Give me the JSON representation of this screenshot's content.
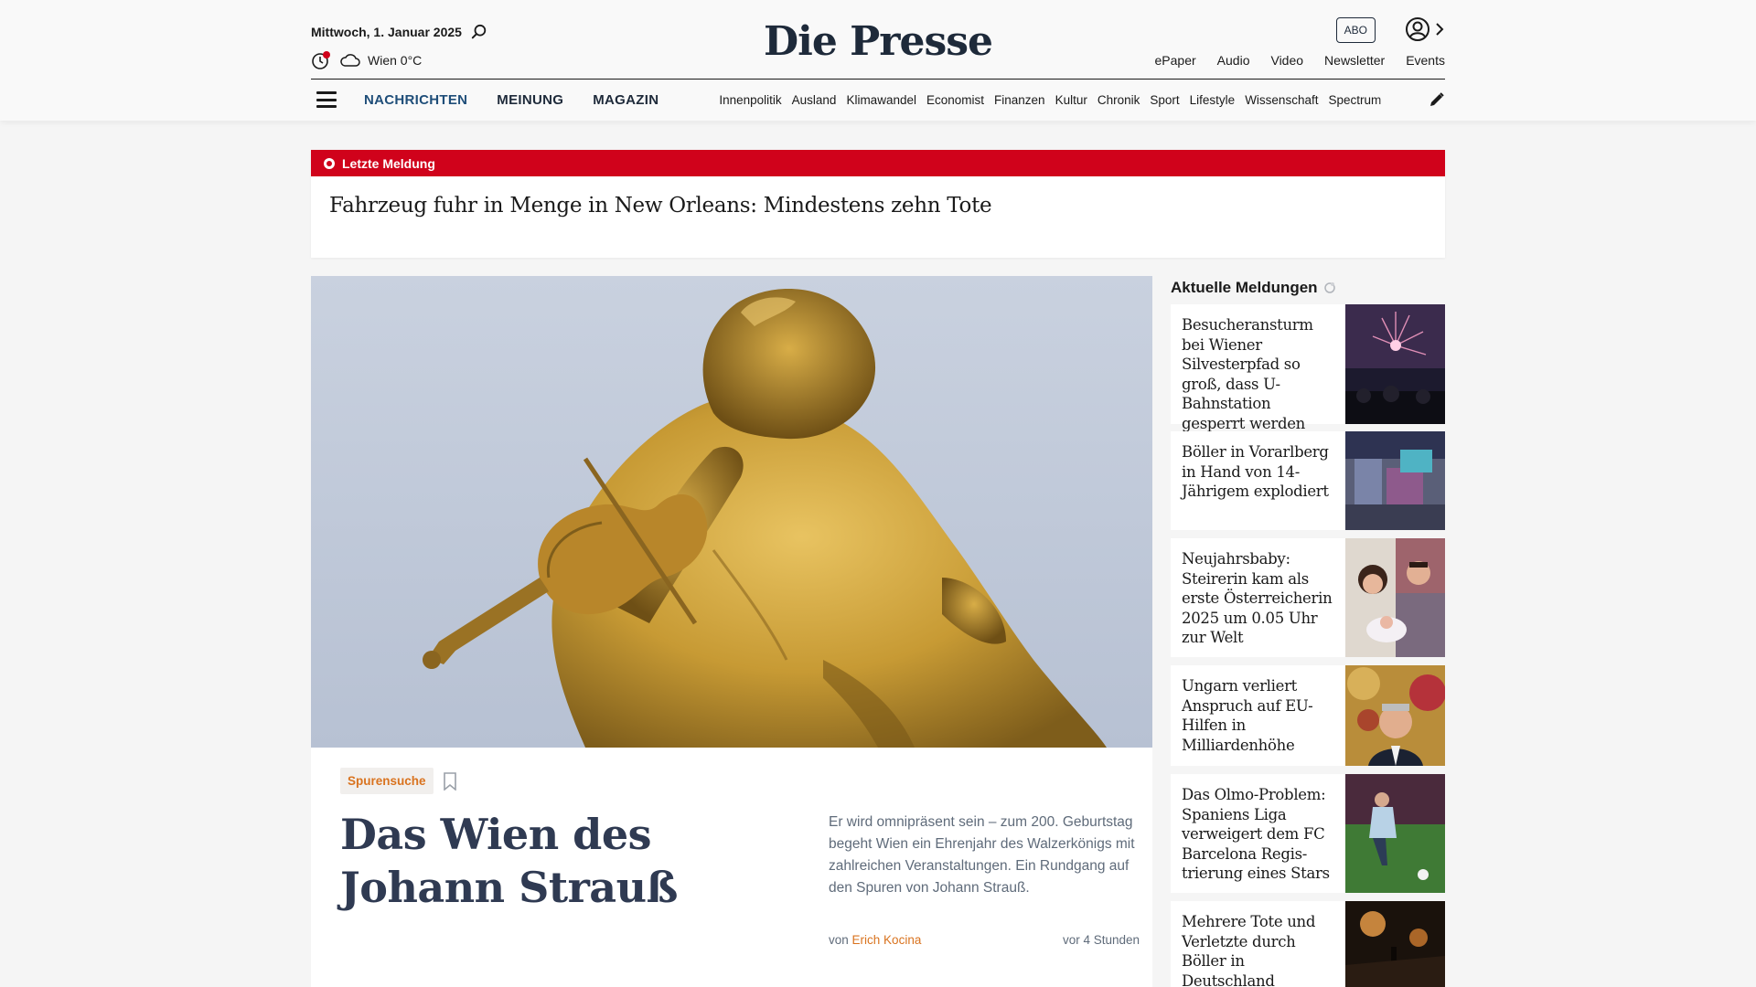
{
  "header": {
    "date": "Mittwoch, 1. Januar 2025",
    "weather": "Wien 0°C",
    "brand": "Die Presse",
    "abo_label": "ABO",
    "top_links": [
      "ePaper",
      "Audio",
      "Video",
      "Newsletter",
      "Events"
    ]
  },
  "nav": {
    "main": [
      "NACHRICHTEN",
      "MEINUNG",
      "MAGAZIN"
    ],
    "sub": [
      "Innenpolitik",
      "Ausland",
      "Klimawandel",
      "Economist",
      "Finanzen",
      "Kultur",
      "Chronik",
      "Sport",
      "Lifestyle",
      "Wissenschaft",
      "Spectrum"
    ]
  },
  "breaking": {
    "label": "Letzte Meldung",
    "title": "Fahrzeug fuhr in Menge in New Orleans: Mindestens zehn Tote"
  },
  "hero": {
    "tag": "Spurensuche",
    "title": "Das Wien des Johann Strauß",
    "lead": "Er wird omnipräsent sein – zum 200. Geburtstag begeht Wien ein Ehrenjahr des Walzerkönigs mit zahlreichen Veranstaltungen. Ein Rundgang auf den Spuren von Johann Strauß.",
    "author_prefix": "von",
    "author": "Erich Kocina",
    "time": "vor 4 Stunden"
  },
  "sidebar": {
    "heading": "Aktuelle Meldungen",
    "items": [
      {
        "title": "Besucheransturm bei Wiener Silvesterpfad so groß, dass U-Bahnstation gesperrt werden musste",
        "thumb": "fireworks"
      },
      {
        "title": "Böller in Vorarlberg in Hand von 14-Jährigem explodiert",
        "thumb": "crowd"
      },
      {
        "title": "Neujahrsbaby: Steirerin kam als erste Österreicherin 2025 um 0.05 Uhr zur Welt",
        "thumb": "family"
      },
      {
        "title": "Ungarn verliert Anspruch auf EU-Hilfen in Milliardenhöhe",
        "thumb": "politician"
      },
      {
        "title": "Das Olmo-Problem: Spaniens Liga verweigert dem FC Barcelona Regis­trierung eines Stars",
        "thumb": "football"
      },
      {
        "title": "Mehrere Tote und Verletzte durch Böller in Deutschland",
        "thumb": "night"
      }
    ]
  },
  "colors": {
    "breaking_red": "#d0021b",
    "accent_orange": "#d9731f",
    "brand_navy": "#1e2a3a"
  }
}
